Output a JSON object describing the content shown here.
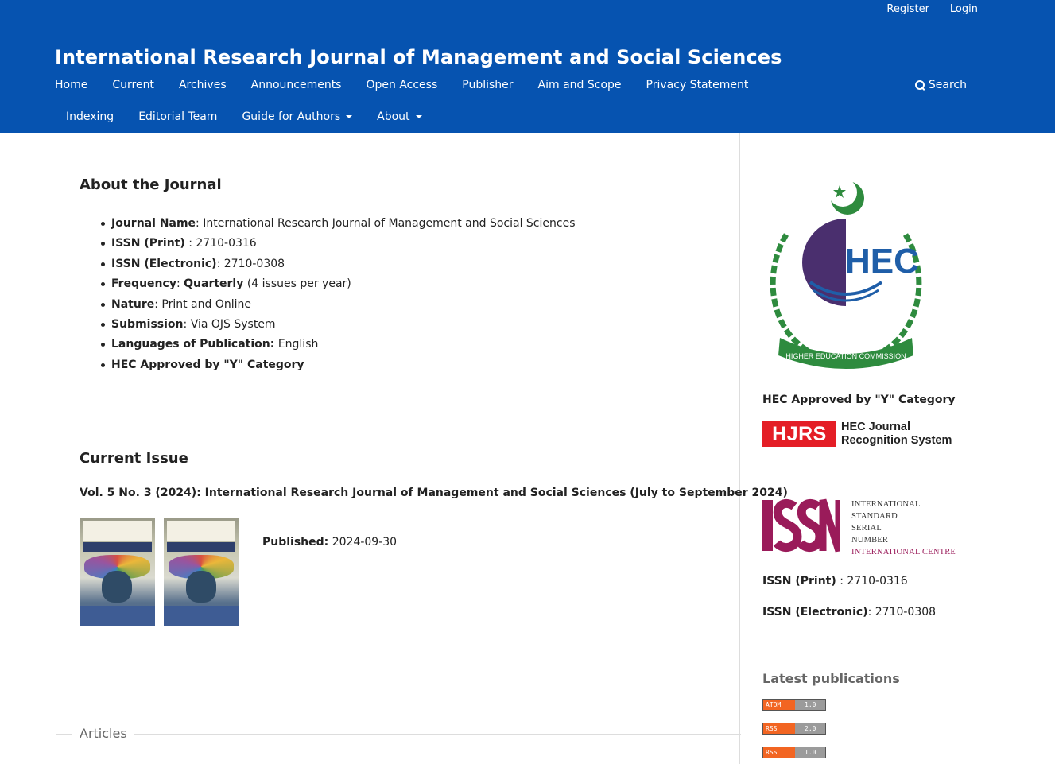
{
  "user_nav": {
    "register": "Register",
    "login": "Login"
  },
  "site_title": "International Research Journal of Management and Social Sciences",
  "nav": {
    "row1": [
      "Home",
      "Current",
      "Archives",
      "Announcements",
      "Open Access",
      "Publisher",
      "Aim and Scope",
      "Privacy Statement"
    ],
    "row2": [
      "Indexing",
      "Editorial Team",
      "Guide for Authors",
      "About"
    ],
    "search": "Search"
  },
  "about": {
    "heading": "About the Journal",
    "items": [
      {
        "label": "Journal Name",
        "sep": ": ",
        "value": "International Research Journal of Management and Social Sciences"
      },
      {
        "label": "ISSN (Print)",
        "sep": " : ",
        "value": "2710-0316"
      },
      {
        "label": "ISSN (Electronic)",
        "sep": ": ",
        "value": "2710-0308"
      },
      {
        "label": "Frequency",
        "sep": ": ",
        "value_bold": "Quarterly",
        "value": " (4 issues per year)"
      },
      {
        "label": "Nature",
        "sep": ": ",
        "value": "Print and Online"
      },
      {
        "label": "Submission",
        "sep": ": ",
        "value": "Via OJS System"
      },
      {
        "label": "Languages of Publication:",
        "sep": " ",
        "value": "English"
      },
      {
        "label": "HEC Approved by \"Y\" Category",
        "sep": "",
        "value": ""
      }
    ]
  },
  "current_issue": {
    "heading": "Current Issue",
    "title": "Vol. 5 No. 3 (2024): International Research Journal of Management and Social Sciences (July to September 2024)",
    "published_label": "Published:",
    "published_date": "2024-09-30"
  },
  "articles_label": "Articles",
  "sidebar": {
    "hec_logo_text": "HIGHER EDUCATION COMMISSION",
    "hec_caption": "HEC Approved by \"Y\" Category",
    "hjrs_badge": "HJRS",
    "hjrs_line1": "HEC Journal",
    "hjrs_line2": "Recognition System",
    "issn_lines": [
      "INTERNATIONAL",
      "STANDARD",
      "SERIAL",
      "NUMBER",
      "INTERNATIONAL CENTRE"
    ],
    "issn_print_label": "ISSN (Print)",
    "issn_print_value": " : 2710-0316",
    "issn_electronic_label": "ISSN (Electronic)",
    "issn_electronic_value": ": 2710-0308",
    "latest_heading": "Latest publications",
    "feeds": [
      {
        "type": "ATOM",
        "version": "1.0"
      },
      {
        "type": "RSS",
        "version": "2.0"
      },
      {
        "type": "RSS",
        "version": "1.0"
      }
    ]
  },
  "colors": {
    "header_bg": "#0653b0",
    "hjrs_red": "#e41e26",
    "issn_magenta": "#9a1b5a",
    "hec_green": "#2e8b3e",
    "feed_orange": "#f26522"
  }
}
